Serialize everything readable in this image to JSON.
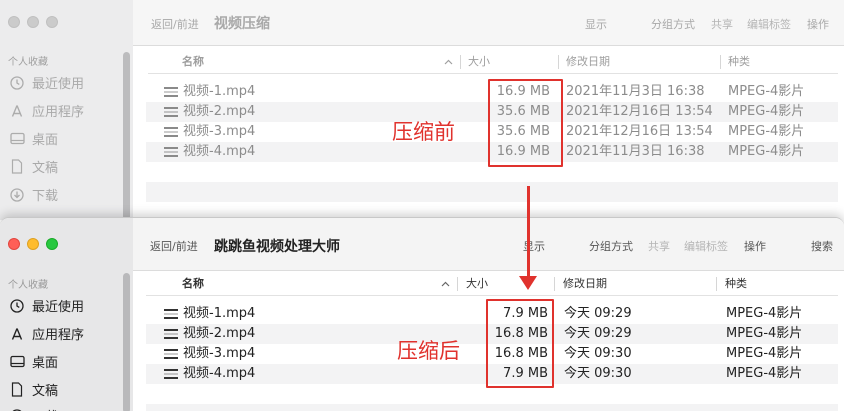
{
  "top": {
    "nav_label": "返回/前进",
    "title": "视频压缩",
    "toolbar": {
      "show": "显示",
      "group": "分组方式",
      "share": "共享",
      "tags": "编辑标签",
      "actions": "操作"
    },
    "sidebar": {
      "section": "个人收藏",
      "items": [
        {
          "label": "最近使用",
          "icon": "clock-icon"
        },
        {
          "label": "应用程序",
          "icon": "applications-icon"
        },
        {
          "label": "桌面",
          "icon": "desktop-icon"
        },
        {
          "label": "文稿",
          "icon": "document-icon"
        },
        {
          "label": "下载",
          "icon": "download-icon"
        }
      ]
    },
    "columns": {
      "name": "名称",
      "size": "大小",
      "date": "修改日期",
      "kind": "种类"
    },
    "files": [
      {
        "name": "视频-1.mp4",
        "size": "16.9 MB",
        "date": "2021年11月3日 16:38",
        "kind": "MPEG-4影片"
      },
      {
        "name": "视频-2.mp4",
        "size": "35.6 MB",
        "date": "2021年12月16日 13:54",
        "kind": "MPEG-4影片"
      },
      {
        "name": "视频-3.mp4",
        "size": "35.6 MB",
        "date": "2021年12月16日 13:54",
        "kind": "MPEG-4影片"
      },
      {
        "name": "视频-4.mp4",
        "size": "16.9 MB",
        "date": "2021年11月3日 16:38",
        "kind": "MPEG-4影片"
      }
    ]
  },
  "bottom": {
    "nav_label": "返回/前进",
    "title": "跳跳鱼视频处理大师",
    "toolbar": {
      "show": "显示",
      "group": "分组方式",
      "share": "共享",
      "tags": "编辑标签",
      "actions": "操作",
      "search": "搜索"
    },
    "sidebar": {
      "section": "个人收藏",
      "items": [
        {
          "label": "最近使用",
          "icon": "clock-icon"
        },
        {
          "label": "应用程序",
          "icon": "applications-icon"
        },
        {
          "label": "桌面",
          "icon": "desktop-icon"
        },
        {
          "label": "文稿",
          "icon": "document-icon"
        },
        {
          "label": "下载",
          "icon": "download-icon"
        }
      ]
    },
    "columns": {
      "name": "名称",
      "size": "大小",
      "date": "修改日期",
      "kind": "种类"
    },
    "files": [
      {
        "name": "视频-1.mp4",
        "size": "7.9 MB",
        "date": "今天 09:29",
        "kind": "MPEG-4影片"
      },
      {
        "name": "视频-2.mp4",
        "size": "16.8 MB",
        "date": "今天 09:29",
        "kind": "MPEG-4影片"
      },
      {
        "name": "视频-3.mp4",
        "size": "16.8 MB",
        "date": "今天 09:30",
        "kind": "MPEG-4影片"
      },
      {
        "name": "视频-4.mp4",
        "size": "7.9 MB",
        "date": "今天 09:30",
        "kind": "MPEG-4影片"
      }
    ]
  },
  "annotations": {
    "before": "压缩前",
    "after": "压缩后",
    "color": "#e0322d"
  }
}
